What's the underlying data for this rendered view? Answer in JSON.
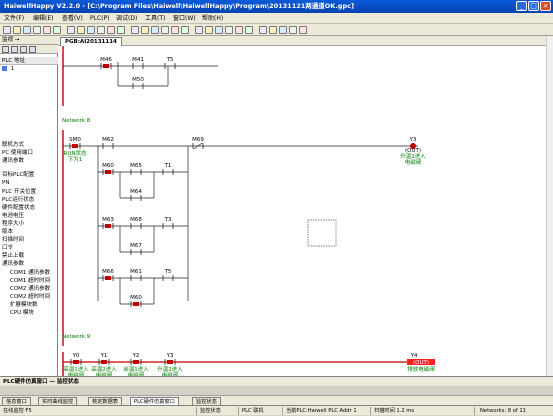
{
  "window": {
    "title": "HaiwellHappy V2.2.0 - [C:\\Program Files\\Haiwell\\HaiwellHappy\\Program\\20131121两通道OK.gpc]",
    "controls": [
      "_",
      "□",
      "×"
    ]
  },
  "menu": [
    "文件(F)",
    "编辑(E)",
    "查看(V)",
    "PLC(P)",
    "调试(D)",
    "工具(T)",
    "窗口(W)",
    "帮助(H)"
  ],
  "left_panel": {
    "header": "监视 →",
    "address_header": "PLC 地址",
    "address_value": "1",
    "tree": [
      {
        "label": "联机方式",
        "indent": false
      },
      {
        "label": "PC 使用端口",
        "indent": false
      },
      {
        "label": "通讯参数",
        "indent": false
      },
      {
        "label": "目标PLC配置",
        "indent": false
      },
      {
        "label": "PN",
        "indent": false
      },
      {
        "label": "PLC 开关位置",
        "indent": false
      },
      {
        "label": "PLC运行状态",
        "indent": false
      },
      {
        "label": "硬件配置状态",
        "indent": false
      },
      {
        "label": "电池电压",
        "indent": false
      },
      {
        "label": "程序大小",
        "indent": false
      },
      {
        "label": "版本",
        "indent": false
      },
      {
        "label": "扫描时间",
        "indent": false
      },
      {
        "label": "口令",
        "indent": false
      },
      {
        "label": "禁止上载",
        "indent": false
      },
      {
        "label": "通讯参数",
        "indent": false
      },
      {
        "label": "COM1 通讯参数",
        "indent": true
      },
      {
        "label": "COM1 超时时间",
        "indent": true
      },
      {
        "label": "COM2 通讯参数",
        "indent": true
      },
      {
        "label": "COM2 超时时间",
        "indent": true
      },
      {
        "label": "扩展模块数",
        "indent": true
      },
      {
        "label": "CPU 模块",
        "indent": true
      }
    ]
  },
  "editor": {
    "doc_tab": "PGB:AI20131114",
    "network_labels": [
      "Network 8",
      "Network 9"
    ],
    "rung_top": {
      "contacts": [
        "M46",
        "M41",
        "T5",
        "M50"
      ]
    },
    "rung_main": {
      "contacts": [
        {
          "addr": "SM0",
          "comment": "RUN状态\n下为1"
        },
        {
          "addr": "M62"
        },
        {
          "addr": "M69"
        },
        {
          "addr": "M60"
        },
        {
          "addr": "M65"
        },
        {
          "addr": "T1"
        },
        {
          "addr": "M64"
        },
        {
          "addr": "M63"
        },
        {
          "addr": "M68"
        },
        {
          "addr": "T3"
        },
        {
          "addr": "M67"
        },
        {
          "addr": "M66"
        },
        {
          "addr": "M61"
        },
        {
          "addr": "T5"
        },
        {
          "addr": "M60"
        }
      ],
      "coil": {
        "addr": "Y3",
        "text": "(OUT)",
        "comment": "升温2进入\n电磁阀"
      }
    },
    "rung_bottom": {
      "contacts": [
        {
          "addr": "Y0",
          "comment": "高温1进入\n电磁阀"
        },
        {
          "addr": "Y1",
          "comment": "高温2进入\n电磁阀"
        },
        {
          "addr": "Y2",
          "comment": "余温1进入\n电磁阀"
        },
        {
          "addr": "Y3",
          "comment": "升温2进入\n电磁阀"
        }
      ],
      "coil": {
        "addr": "Y4",
        "text": "(OUT)",
        "comment": "排放电磁阀"
      }
    }
  },
  "bottom_panel": {
    "title": "PLC硬件仿真窗口  —  监控状态",
    "tabs": [
      "信息窗口",
      "实时曲线监控",
      "核定数据表",
      "PLC硬件仿真窗口",
      "监控状态"
    ]
  },
  "status": {
    "left": "在线监控  F5",
    "mode": "监控状态",
    "connection": "PLC 联机",
    "plc": "当前PLC:Haiwell PLC Addr 1",
    "scan": "扫描时间 1.2 ms",
    "networks": "Networks: 8 of 11"
  },
  "colors": {
    "rail": "#c00000",
    "active": "#c00000",
    "comment_green": "#008000",
    "network_label": "#008000",
    "coil_active_bg": "#ff2020"
  }
}
